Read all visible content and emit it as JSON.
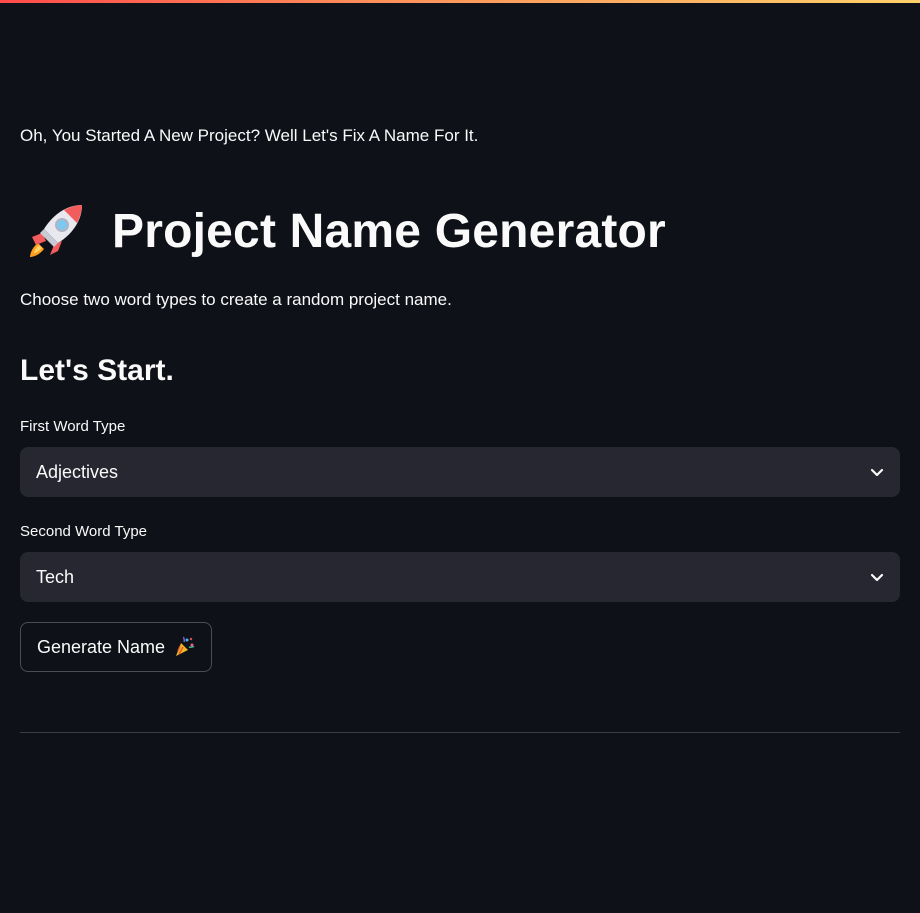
{
  "intro_text": "Oh, You Started A New Project? Well Let's Fix A Name For It.",
  "page_title": "Project Name Generator",
  "title_icon": "rocket-icon",
  "subtitle": "Choose two word types to create a random project name.",
  "section_heading": "Let's Start.",
  "first_select": {
    "label": "First Word Type",
    "value": "Adjectives"
  },
  "second_select": {
    "label": "Second Word Type",
    "value": "Tech"
  },
  "generate_button": {
    "label": "Generate Name",
    "icon": "party-popper-icon"
  },
  "colors": {
    "background": "#0e1117",
    "select_background": "#262730",
    "text": "#fafafa",
    "accent_gradient_start": "#ff4b4b",
    "accent_gradient_end": "#ffd16a"
  }
}
